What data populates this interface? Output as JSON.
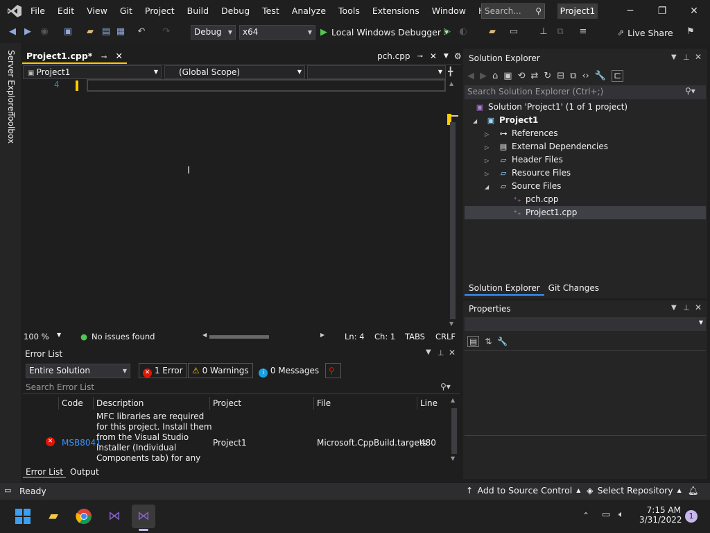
{
  "menu": [
    "File",
    "Edit",
    "View",
    "Git",
    "Project",
    "Build",
    "Debug",
    "Test",
    "Analyze",
    "Tools",
    "Extensions",
    "Window",
    "Help"
  ],
  "search": {
    "placeholder": "Search..."
  },
  "window_title": "Project1",
  "toolbar": {
    "config": "Debug",
    "platform": "x64",
    "run_label": "Local Windows Debugger",
    "live_share": "Live Share"
  },
  "sidebar": {
    "server_explorer": "Server Explorer",
    "toolbox": "Toolbox"
  },
  "editor": {
    "active_tab": "Project1.cpp*",
    "secondary_tab": "pch.cpp",
    "nav_project": "Project1",
    "nav_scope": "(Global Scope)",
    "line_number": "4",
    "zoom": "100 %",
    "issues": "No issues found",
    "ln": "Ln: 4",
    "ch": "Ch: 1",
    "tabs": "TABS",
    "eol": "CRLF"
  },
  "error_list": {
    "title": "Error List",
    "scope": "Entire Solution",
    "errors": "1 Error",
    "warnings": "0 Warnings",
    "messages": "0 Messages",
    "search_placeholder": "Search Error List",
    "columns": {
      "code": "Code",
      "description": "Description",
      "project": "Project",
      "file": "File",
      "line": "Line"
    },
    "row": {
      "code": "MSB8041",
      "description": "MFC libraries are required for this project. Install them from the Visual Studio installer (Individual Components tab) for any toolsets and",
      "project": "Project1",
      "file": "Microsoft.CppBuild.targets",
      "line": "480"
    },
    "bottom_tabs": [
      "Error List",
      "Output"
    ]
  },
  "solution_explorer": {
    "title": "Solution Explorer",
    "search_placeholder": "Search Solution Explorer (Ctrl+;)",
    "solution": "Solution 'Project1' (1 of 1 project)",
    "project": "Project1",
    "nodes": [
      "References",
      "External Dependencies",
      "Header Files",
      "Resource Files",
      "Source Files"
    ],
    "files": [
      "pch.cpp",
      "Project1.cpp"
    ],
    "bottom_tabs": [
      "Solution Explorer",
      "Git Changes"
    ]
  },
  "properties": {
    "title": "Properties"
  },
  "statusbar": {
    "ready": "Ready",
    "add_source": "Add to Source Control",
    "select_repo": "Select Repository"
  },
  "taskbar": {
    "time": "7:15 AM",
    "date": "3/31/2022",
    "notifications": "1"
  },
  "colors": {
    "accent": "#68217a",
    "error": "#e51400",
    "vs_purple": "#8661c5",
    "active_tab_marker": "#ffcc00"
  }
}
